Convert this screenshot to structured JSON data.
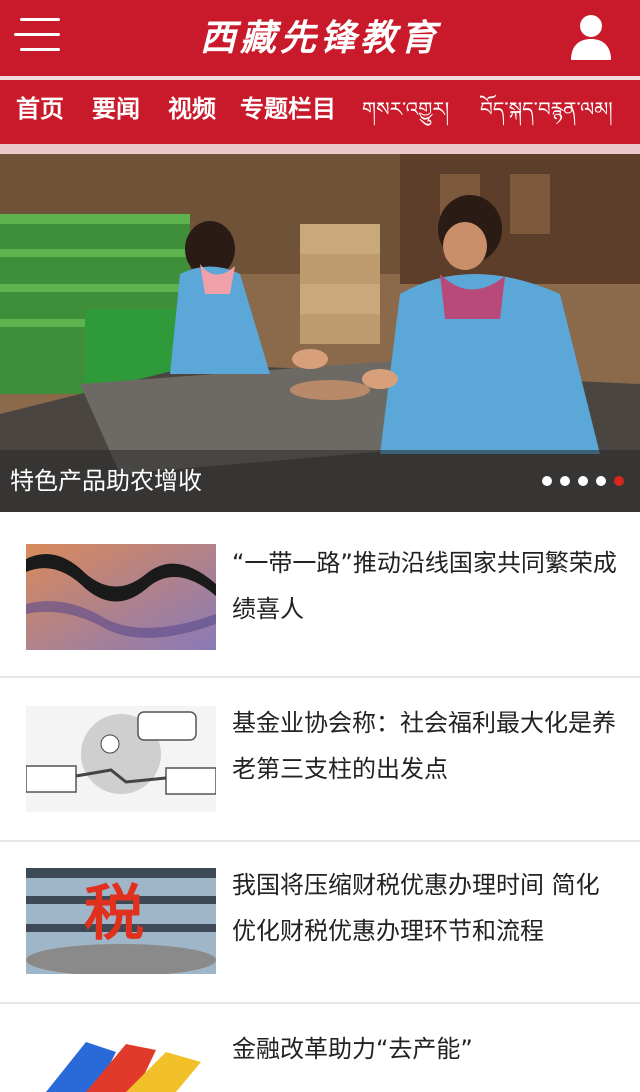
{
  "header": {
    "logo_text": "西藏先锋教育",
    "menu_icon": "menu-icon",
    "user_icon": "user-icon",
    "brand_color": "#c91a2b"
  },
  "nav": {
    "items": [
      {
        "label": "首页"
      },
      {
        "label": "要闻"
      },
      {
        "label": "视频"
      },
      {
        "label": "专题栏目"
      },
      {
        "label": "གསར་འགྱུར།"
      },
      {
        "label": "བོད་སྐད་བརྙན་ལམ།"
      }
    ]
  },
  "hero": {
    "caption": "特色产品助农增收",
    "slide_count": 5,
    "active_slide": 5,
    "active_dot_color": "#d9261c",
    "dot_color": "#ffffff"
  },
  "news": [
    {
      "title": "“一带一路”推动沿线国家共同繁荣成绩喜人"
    },
    {
      "title": "基金业协会称：社会福利最大化是养老第三支柱的出发点"
    },
    {
      "title": "我国将压缩财税优惠办理时间 简化优化财税优惠办理环节和流程"
    },
    {
      "title": "金融改革助力“去产能”"
    }
  ]
}
